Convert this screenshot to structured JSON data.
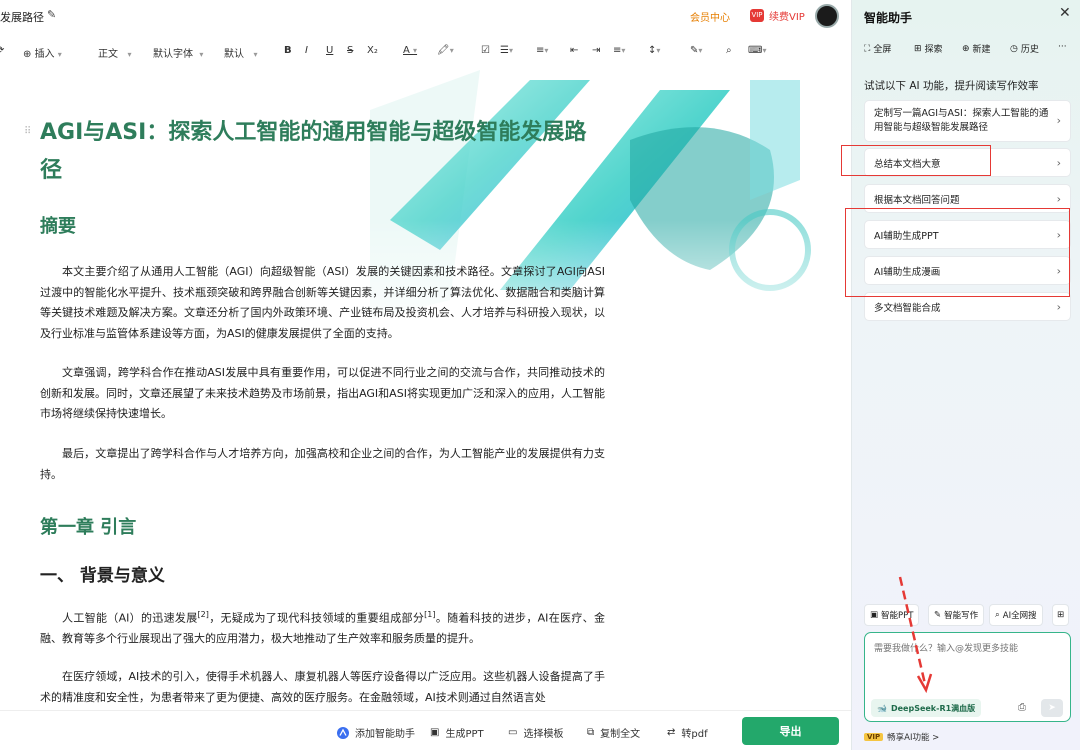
{
  "header": {
    "doc_title": "发展路径",
    "member_center": "会员中心",
    "vip_badge": "VIP",
    "renew_vip": "续费VIP"
  },
  "toolbar": {
    "insert": "插入",
    "style": "正文",
    "font": "默认字体",
    "size": "默认",
    "bold": "B",
    "italic": "I",
    "underline": "U",
    "strike": "S",
    "subscript": "X₂"
  },
  "document": {
    "title": "AGI与ASI：探索人工智能的通用智能与超级智能发展路径",
    "abstract_heading": "摘要",
    "para1": "本文主要介绍了从通用人工智能（AGI）向超级智能（ASI）发展的关键因素和技术路径。文章探讨了AGI向ASI过渡中的智能化水平提升、技术瓶颈突破和跨界融合创新等关键因素，并详细分析了算法优化、数据融合和类脑计算等关键技术难题及解决方案。文章还分析了国内外政策环境、产业链布局及投资机会、人才培养与科研投入现状，以及行业标准与监管体系建设等方面，为ASI的健康发展提供了全面的支持。",
    "para2": "文章强调，跨学科合作在推动ASI发展中具有重要作用，可以促进不同行业之间的交流与合作，共同推动技术的创新和发展。同时，文章还展望了未来技术趋势及市场前景，指出AGI和ASI将实现更加广泛和深入的应用，人工智能市场将继续保持快速增长。",
    "para3": "最后，文章提出了跨学科合作与人才培养方向，加强高校和企业之间的合作，为人工智能产业的发展提供有力支持。",
    "chapter1": "第一章 引言",
    "section1": "一、 背景与意义",
    "para4_a": "人工智能（AI）的迅速发展",
    "para4_ref1": "[2]",
    "para4_b": "，无疑成为了现代科技领域的重要组成部分",
    "para4_ref2": "[1]",
    "para4_c": "。随着科技的进步，AI在医疗、金融、教育等多个行业展现出了强大的应用潜力，极大地推动了生产效率和服务质量的提升。",
    "para5": "在医疗领域，AI技术的引入，使得手术机器人、康复机器人等医疗设备得以广泛应用。这些机器人设备提高了手术的精准度和安全性，为患者带来了更为便捷、高效的医疗服务。在金融领域，AI技术则通过自然语言处"
  },
  "bottombar": {
    "add_assistant": "添加智能助手",
    "gen_ppt": "生成PPT",
    "choose_template": "选择模板",
    "copy_all": "复制全文",
    "to_pdf": "转pdf",
    "export": "导出"
  },
  "panel": {
    "title": "智能助手",
    "tabs": [
      "全屏",
      "探索",
      "新建",
      "历史"
    ],
    "more": "···",
    "hint": "试试以下 AI 功能，提升阅读写作效率",
    "cards": [
      "定制写一篇AGI与ASI：探索人工智能的通用智能与超级智能发展路径",
      "总结本文档大意",
      "根据本文档回答问题",
      "AI辅助生成PPT",
      "AI辅助生成漫画",
      "多文档智能合成"
    ],
    "quick": [
      "智能PPT",
      "智能写作",
      "AI全网搜"
    ],
    "input_placeholder": "需要我做什么？输入@发现更多技能",
    "model": "DeepSeek-R1满血版",
    "vip_tag": "VIP",
    "vip_text": "畅享AI功能 >"
  },
  "colors": {
    "heading": "#2e7d5b",
    "accent_green": "#23a86b",
    "annotation_red": "#e53935"
  }
}
